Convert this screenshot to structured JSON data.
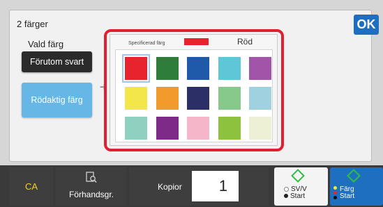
{
  "header": {
    "title": "2 färger",
    "ok_label": "OK"
  },
  "left": {
    "vald_label": "Vald färg",
    "except_black_label": "Förutom svart",
    "reddish_label": "Rödaktig färg"
  },
  "palette": {
    "specified_label": "Specificerad färg",
    "specified_name": "Röd",
    "specified_color": "#e8232e",
    "swatches": [
      {
        "name": "red",
        "color": "#e8232e",
        "selected": true
      },
      {
        "name": "dark-green",
        "color": "#2e7d3a"
      },
      {
        "name": "blue",
        "color": "#1f5aa8"
      },
      {
        "name": "cyan",
        "color": "#5fc6d8"
      },
      {
        "name": "purple",
        "color": "#a055a8"
      },
      {
        "name": "yellow",
        "color": "#f2e64a"
      },
      {
        "name": "orange",
        "color": "#f39a2c"
      },
      {
        "name": "navy",
        "color": "#2b2f66"
      },
      {
        "name": "light-green",
        "color": "#86c98a"
      },
      {
        "name": "light-blue",
        "color": "#9fd1e0"
      },
      {
        "name": "mint",
        "color": "#8fd1c0"
      },
      {
        "name": "violet",
        "color": "#7d2a88"
      },
      {
        "name": "pink",
        "color": "#f4b6c8"
      },
      {
        "name": "lime",
        "color": "#8dc23f"
      },
      {
        "name": "ivory",
        "color": "#eef0d6"
      }
    ]
  },
  "bottom": {
    "ca_label": "CA",
    "preview_label": "Förhandsgr.",
    "copies_label": "Kopior",
    "copies_value": "1",
    "bw_start_line1": "SV/V",
    "bw_start_line2": "Start",
    "color_start_line1": "Färg",
    "color_start_line2": "Start"
  },
  "colors": {
    "accent": "#1d6fc4",
    "highlight_frame": "#e02030",
    "start_green": "#2fbf3f"
  },
  "icons": [
    "magnifier-document-icon",
    "start-diamond-icon",
    "arrow-right-icon"
  ]
}
